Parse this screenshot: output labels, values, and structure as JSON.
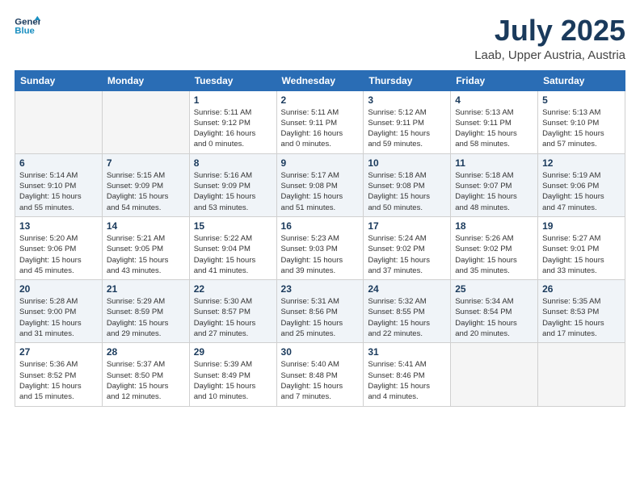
{
  "header": {
    "logo_line1": "General",
    "logo_line2": "Blue",
    "month": "July 2025",
    "location": "Laab, Upper Austria, Austria"
  },
  "weekdays": [
    "Sunday",
    "Monday",
    "Tuesday",
    "Wednesday",
    "Thursday",
    "Friday",
    "Saturday"
  ],
  "weeks": [
    [
      {
        "day": "",
        "empty": true
      },
      {
        "day": "",
        "empty": true
      },
      {
        "day": "1",
        "line1": "Sunrise: 5:11 AM",
        "line2": "Sunset: 9:12 PM",
        "line3": "Daylight: 16 hours",
        "line4": "and 0 minutes."
      },
      {
        "day": "2",
        "line1": "Sunrise: 5:11 AM",
        "line2": "Sunset: 9:11 PM",
        "line3": "Daylight: 16 hours",
        "line4": "and 0 minutes."
      },
      {
        "day": "3",
        "line1": "Sunrise: 5:12 AM",
        "line2": "Sunset: 9:11 PM",
        "line3": "Daylight: 15 hours",
        "line4": "and 59 minutes."
      },
      {
        "day": "4",
        "line1": "Sunrise: 5:13 AM",
        "line2": "Sunset: 9:11 PM",
        "line3": "Daylight: 15 hours",
        "line4": "and 58 minutes."
      },
      {
        "day": "5",
        "line1": "Sunrise: 5:13 AM",
        "line2": "Sunset: 9:10 PM",
        "line3": "Daylight: 15 hours",
        "line4": "and 57 minutes."
      }
    ],
    [
      {
        "day": "6",
        "line1": "Sunrise: 5:14 AM",
        "line2": "Sunset: 9:10 PM",
        "line3": "Daylight: 15 hours",
        "line4": "and 55 minutes."
      },
      {
        "day": "7",
        "line1": "Sunrise: 5:15 AM",
        "line2": "Sunset: 9:09 PM",
        "line3": "Daylight: 15 hours",
        "line4": "and 54 minutes."
      },
      {
        "day": "8",
        "line1": "Sunrise: 5:16 AM",
        "line2": "Sunset: 9:09 PM",
        "line3": "Daylight: 15 hours",
        "line4": "and 53 minutes."
      },
      {
        "day": "9",
        "line1": "Sunrise: 5:17 AM",
        "line2": "Sunset: 9:08 PM",
        "line3": "Daylight: 15 hours",
        "line4": "and 51 minutes."
      },
      {
        "day": "10",
        "line1": "Sunrise: 5:18 AM",
        "line2": "Sunset: 9:08 PM",
        "line3": "Daylight: 15 hours",
        "line4": "and 50 minutes."
      },
      {
        "day": "11",
        "line1": "Sunrise: 5:18 AM",
        "line2": "Sunset: 9:07 PM",
        "line3": "Daylight: 15 hours",
        "line4": "and 48 minutes."
      },
      {
        "day": "12",
        "line1": "Sunrise: 5:19 AM",
        "line2": "Sunset: 9:06 PM",
        "line3": "Daylight: 15 hours",
        "line4": "and 47 minutes."
      }
    ],
    [
      {
        "day": "13",
        "line1": "Sunrise: 5:20 AM",
        "line2": "Sunset: 9:06 PM",
        "line3": "Daylight: 15 hours",
        "line4": "and 45 minutes."
      },
      {
        "day": "14",
        "line1": "Sunrise: 5:21 AM",
        "line2": "Sunset: 9:05 PM",
        "line3": "Daylight: 15 hours",
        "line4": "and 43 minutes."
      },
      {
        "day": "15",
        "line1": "Sunrise: 5:22 AM",
        "line2": "Sunset: 9:04 PM",
        "line3": "Daylight: 15 hours",
        "line4": "and 41 minutes."
      },
      {
        "day": "16",
        "line1": "Sunrise: 5:23 AM",
        "line2": "Sunset: 9:03 PM",
        "line3": "Daylight: 15 hours",
        "line4": "and 39 minutes."
      },
      {
        "day": "17",
        "line1": "Sunrise: 5:24 AM",
        "line2": "Sunset: 9:02 PM",
        "line3": "Daylight: 15 hours",
        "line4": "and 37 minutes."
      },
      {
        "day": "18",
        "line1": "Sunrise: 5:26 AM",
        "line2": "Sunset: 9:02 PM",
        "line3": "Daylight: 15 hours",
        "line4": "and 35 minutes."
      },
      {
        "day": "19",
        "line1": "Sunrise: 5:27 AM",
        "line2": "Sunset: 9:01 PM",
        "line3": "Daylight: 15 hours",
        "line4": "and 33 minutes."
      }
    ],
    [
      {
        "day": "20",
        "line1": "Sunrise: 5:28 AM",
        "line2": "Sunset: 9:00 PM",
        "line3": "Daylight: 15 hours",
        "line4": "and 31 minutes."
      },
      {
        "day": "21",
        "line1": "Sunrise: 5:29 AM",
        "line2": "Sunset: 8:59 PM",
        "line3": "Daylight: 15 hours",
        "line4": "and 29 minutes."
      },
      {
        "day": "22",
        "line1": "Sunrise: 5:30 AM",
        "line2": "Sunset: 8:57 PM",
        "line3": "Daylight: 15 hours",
        "line4": "and 27 minutes."
      },
      {
        "day": "23",
        "line1": "Sunrise: 5:31 AM",
        "line2": "Sunset: 8:56 PM",
        "line3": "Daylight: 15 hours",
        "line4": "and 25 minutes."
      },
      {
        "day": "24",
        "line1": "Sunrise: 5:32 AM",
        "line2": "Sunset: 8:55 PM",
        "line3": "Daylight: 15 hours",
        "line4": "and 22 minutes."
      },
      {
        "day": "25",
        "line1": "Sunrise: 5:34 AM",
        "line2": "Sunset: 8:54 PM",
        "line3": "Daylight: 15 hours",
        "line4": "and 20 minutes."
      },
      {
        "day": "26",
        "line1": "Sunrise: 5:35 AM",
        "line2": "Sunset: 8:53 PM",
        "line3": "Daylight: 15 hours",
        "line4": "and 17 minutes."
      }
    ],
    [
      {
        "day": "27",
        "line1": "Sunrise: 5:36 AM",
        "line2": "Sunset: 8:52 PM",
        "line3": "Daylight: 15 hours",
        "line4": "and 15 minutes."
      },
      {
        "day": "28",
        "line1": "Sunrise: 5:37 AM",
        "line2": "Sunset: 8:50 PM",
        "line3": "Daylight: 15 hours",
        "line4": "and 12 minutes."
      },
      {
        "day": "29",
        "line1": "Sunrise: 5:39 AM",
        "line2": "Sunset: 8:49 PM",
        "line3": "Daylight: 15 hours",
        "line4": "and 10 minutes."
      },
      {
        "day": "30",
        "line1": "Sunrise: 5:40 AM",
        "line2": "Sunset: 8:48 PM",
        "line3": "Daylight: 15 hours",
        "line4": "and 7 minutes."
      },
      {
        "day": "31",
        "line1": "Sunrise: 5:41 AM",
        "line2": "Sunset: 8:46 PM",
        "line3": "Daylight: 15 hours",
        "line4": "and 4 minutes."
      },
      {
        "day": "",
        "empty": true
      },
      {
        "day": "",
        "empty": true
      }
    ]
  ]
}
